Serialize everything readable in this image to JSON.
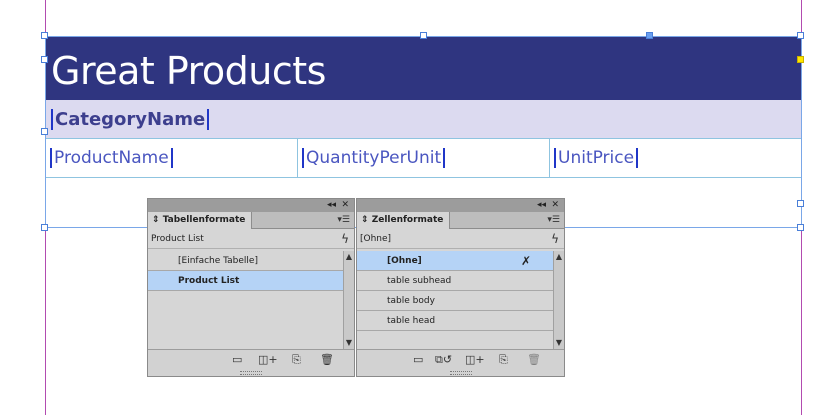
{
  "document": {
    "title": "Great Products",
    "category_placeholder": "CategoryName",
    "columns": [
      "ProductName",
      "QuantityPerUnit",
      "UnitPrice"
    ]
  },
  "table_styles_panel": {
    "tab_label": "Tabellenformate",
    "current_style": "Product List",
    "items": [
      "[Einfache Tabelle]",
      "Product List"
    ],
    "selected": "Product List"
  },
  "cell_styles_panel": {
    "tab_label": "Zellenformate",
    "current_style": "[Ohne]",
    "items": [
      "[Ohne]",
      "table subhead",
      "table body",
      "table head"
    ],
    "selected": "[Ohne]"
  },
  "colors": {
    "title_bg": "#2f3580",
    "category_bg": "#dcdaf0",
    "selection": "#b5d3f6",
    "guide": "#b24bb0"
  },
  "icons": {
    "collapse": "double-left-arrow-icon",
    "close": "close-icon",
    "menu": "panel-menu-icon",
    "lightning": "lightning-icon",
    "folder": "folder-icon",
    "new_style": "new-style-icon",
    "new_page": "new-item-icon",
    "trash": "trash-icon",
    "clear_override": "clear-override-icon"
  }
}
